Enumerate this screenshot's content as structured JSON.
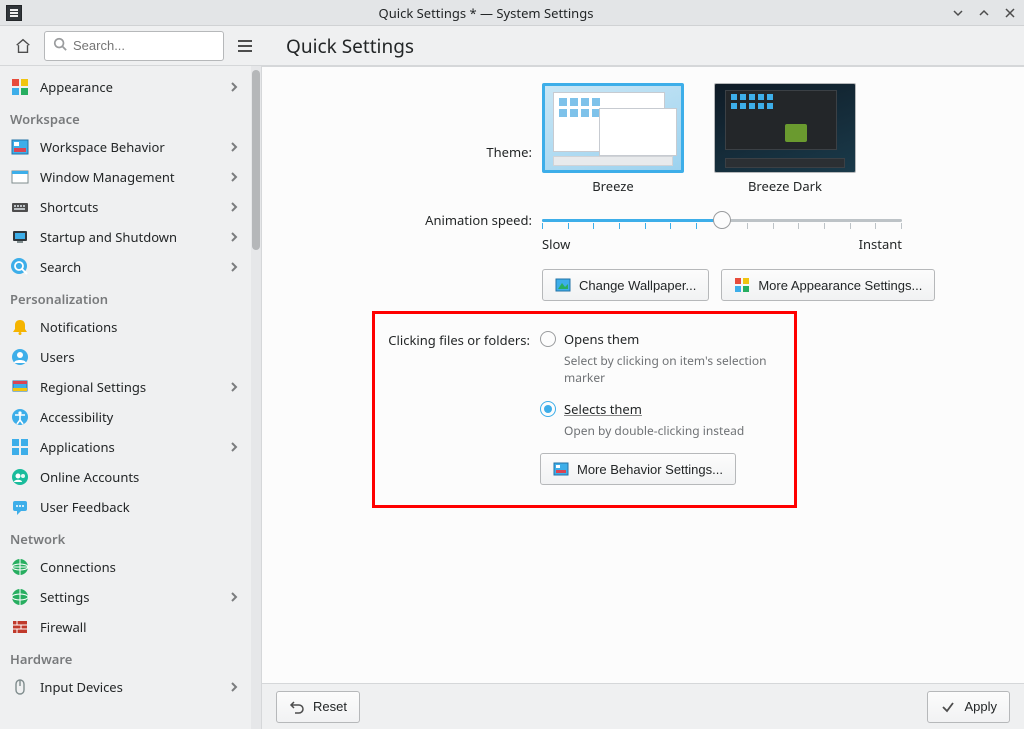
{
  "window": {
    "title": "Quick Settings * — System Settings"
  },
  "toolbar": {
    "search_placeholder": "Search...",
    "page_title": "Quick Settings"
  },
  "sidebar": {
    "top": [
      {
        "label": "Appearance",
        "icon": "appearance",
        "chevron": true
      }
    ],
    "groups": [
      {
        "header": "Workspace",
        "items": [
          {
            "label": "Workspace Behavior",
            "icon": "workspace-behavior",
            "chevron": true
          },
          {
            "label": "Window Management",
            "icon": "window-management",
            "chevron": true
          },
          {
            "label": "Shortcuts",
            "icon": "shortcuts",
            "chevron": true
          },
          {
            "label": "Startup and Shutdown",
            "icon": "startup-shutdown",
            "chevron": true
          },
          {
            "label": "Search",
            "icon": "search",
            "chevron": true
          }
        ]
      },
      {
        "header": "Personalization",
        "items": [
          {
            "label": "Notifications",
            "icon": "notifications",
            "chevron": false
          },
          {
            "label": "Users",
            "icon": "users",
            "chevron": false
          },
          {
            "label": "Regional Settings",
            "icon": "regional",
            "chevron": true
          },
          {
            "label": "Accessibility",
            "icon": "accessibility",
            "chevron": false
          },
          {
            "label": "Applications",
            "icon": "applications",
            "chevron": true
          },
          {
            "label": "Online Accounts",
            "icon": "online-accounts",
            "chevron": false
          },
          {
            "label": "User Feedback",
            "icon": "user-feedback",
            "chevron": false
          }
        ]
      },
      {
        "header": "Network",
        "items": [
          {
            "label": "Connections",
            "icon": "connections",
            "chevron": false
          },
          {
            "label": "Settings",
            "icon": "net-settings",
            "chevron": true
          },
          {
            "label": "Firewall",
            "icon": "firewall",
            "chevron": false
          }
        ]
      },
      {
        "header": "Hardware",
        "items": [
          {
            "label": "Input Devices",
            "icon": "input-devices",
            "chevron": true
          }
        ]
      }
    ]
  },
  "content": {
    "theme_label": "Theme:",
    "themes": [
      {
        "name": "Breeze",
        "selected": true
      },
      {
        "name": "Breeze Dark",
        "selected": false
      }
    ],
    "animation_label": "Animation speed:",
    "animation_min": "Slow",
    "animation_max": "Instant",
    "animation_value_percent": 50,
    "change_wallpaper": "Change Wallpaper...",
    "more_appearance": "More Appearance Settings...",
    "click_label": "Clicking files or folders:",
    "radio_open": {
      "label": "Opens them",
      "hint": "Select by clicking on item's selection marker",
      "checked": false
    },
    "radio_select": {
      "label": "Selects them",
      "hint": "Open by double-clicking instead",
      "checked": true
    },
    "more_behavior": "More Behavior Settings..."
  },
  "footer": {
    "reset": "Reset",
    "apply": "Apply"
  }
}
